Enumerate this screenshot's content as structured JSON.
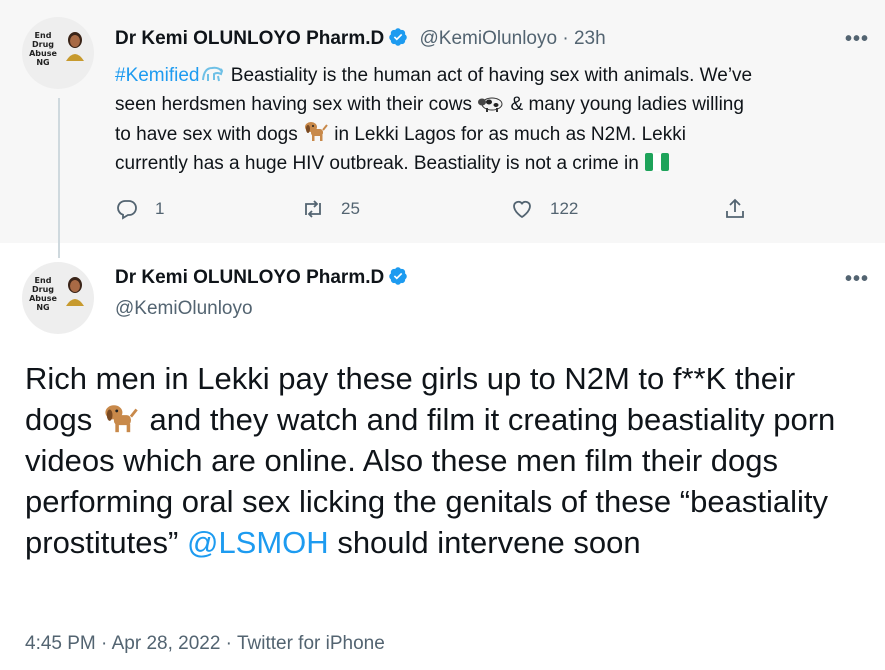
{
  "parent_tweet": {
    "avatar_text": "End Drug Abuse NG",
    "display_name": "Dr Kemi OLUNLOYO Pharm.D",
    "handle": "@KemiOlunloyo",
    "separator": "·",
    "time_ago": "23h",
    "hashtag": "#Kemified",
    "text_line1": "Beastiality is the human act of having sex with animals. We’ve",
    "text_line2_a": "seen herdsmen having sex with their cows",
    "text_line2_b": "& many young ladies willing",
    "text_line3_a": "to have sex with dogs",
    "text_line3_b": "in Lekki Lagos for as much as N2M. Lekki",
    "text_line4": "currently has a huge HIV outbreak. Beastiality is not a crime in",
    "reply_count": "1",
    "retweet_count": "25",
    "like_count": "122",
    "more_label": "•••"
  },
  "main_tweet": {
    "display_name": "Dr Kemi OLUNLOYO Pharm.D",
    "handle": "@KemiOlunloyo",
    "text_a": "Rich men in Lekki pay these girls up to N2M to f**K their dogs",
    "text_b": "and they watch and film it creating beastiality porn videos which are online. Also these men film their dogs performing oral sex licking the genitals of these “beastiality prostitutes”",
    "mention": "@LSMOH",
    "text_c": "should intervene soon",
    "timestamp": "4:45 PM · Apr 28, 2022 · Twitter for iPhone",
    "more_label": "•••"
  },
  "colors": {
    "accent": "#1d9bf0",
    "muted": "#536471",
    "parent_bg": "#f7f7f7",
    "nigeria_green": "#1ea35a"
  },
  "icons": [
    "verified-badge-icon",
    "reply-icon",
    "retweet-icon",
    "like-icon",
    "share-icon",
    "more-icon",
    "dog-emoji-icon",
    "cow-emoji-icon",
    "nigeria-flag-icon",
    "hashtag-emoji-icon"
  ]
}
